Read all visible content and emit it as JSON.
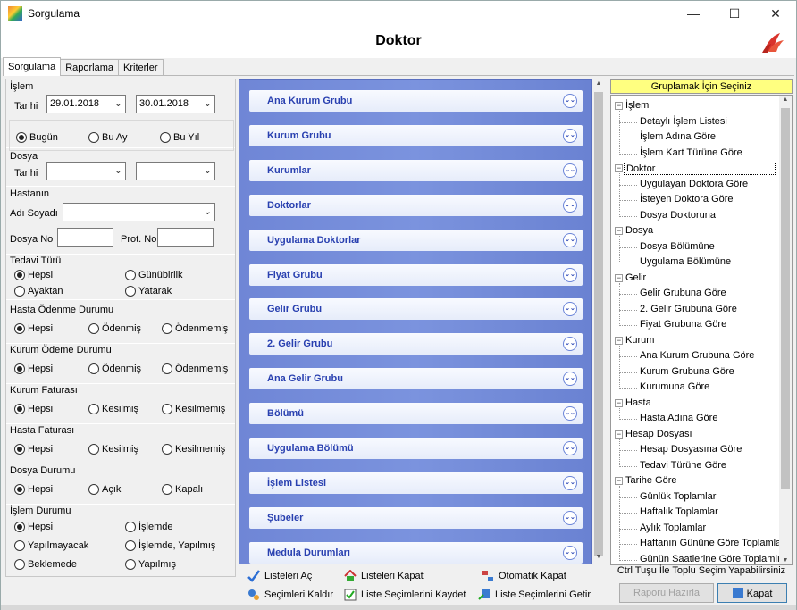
{
  "window": {
    "title": "Sorgulama",
    "min": "—",
    "max": "☐",
    "close": "✕"
  },
  "header": {
    "title": "Doktor"
  },
  "tabs": [
    "Sorgulama",
    "Raporlama",
    "Kriterler"
  ],
  "left": {
    "islem": {
      "title": "İşlem",
      "tarihi_label": "Tarihi",
      "date_from": "29.01.2018",
      "date_to": "30.01.2018",
      "radios": [
        "Bugün",
        "Bu Ay",
        "Bu Yıl"
      ]
    },
    "dosya": {
      "title": "Dosya",
      "tarihi_label": "Tarihi"
    },
    "hastanin": {
      "title": "Hastanın",
      "adi_label": "Adı Soyadı",
      "dosya_no_label": "Dosya No",
      "prot_no_label": "Prot. No"
    },
    "tedavi": {
      "title": "Tedavi Türü",
      "opts": [
        "Hepsi",
        "Günübirlik",
        "Ayaktan",
        "Yatarak"
      ]
    },
    "hasta_odeme": {
      "title": "Hasta Ödenme Durumu",
      "opts": [
        "Hepsi",
        "Ödenmiş",
        "Ödenmemiş"
      ]
    },
    "kurum_odeme": {
      "title": "Kurum Ödeme Durumu",
      "opts": [
        "Hepsi",
        "Ödenmiş",
        "Ödenmemiş"
      ]
    },
    "kurum_fatura": {
      "title": "Kurum Faturası",
      "opts": [
        "Hepsi",
        "Kesilmiş",
        "Kesilmemiş"
      ]
    },
    "hasta_fatura": {
      "title": "Hasta Faturası",
      "opts": [
        "Hepsi",
        "Kesilmiş",
        "Kesilmemiş"
      ]
    },
    "dosya_durum": {
      "title": "Dosya Durumu",
      "opts": [
        "Hepsi",
        "Açık",
        "Kapalı"
      ]
    },
    "islem_durum": {
      "title": "İşlem Durumu",
      "opts": [
        "Hepsi",
        "İşlemde",
        "Yapılmayacak",
        "İşlemde, Yapılmış",
        "Beklemede",
        "Yapılmış"
      ]
    }
  },
  "groups": [
    "Ana Kurum Grubu",
    "Kurum Grubu",
    "Kurumlar",
    "Doktorlar",
    "Uygulama Doktorlar",
    "Fiyat Grubu",
    "Gelir Grubu",
    "2. Gelir Grubu",
    "Ana Gelir Grubu",
    "Bölümü",
    "Uygulama Bölümü",
    "İşlem Listesi",
    "Şubeler",
    "Medula Durumları"
  ],
  "actions": {
    "listeleri_ac": "Listeleri Aç",
    "listeleri_kapat": "Listeleri Kapat",
    "otomatik_kapat": "Otomatik Kapat",
    "secimleri_kaldir": "Seçimleri Kaldır",
    "liste_kaydet": "Liste Seçimlerini Kaydet",
    "liste_getir": "Liste Seçimlerini Getir"
  },
  "tree": {
    "header": "Gruplamak İçin Seçiniz",
    "nodes": [
      {
        "label": "İşlem",
        "children": [
          "Detaylı İşlem Listesi",
          "İşlem Adına Göre",
          "İşlem Kart Türüne Göre"
        ]
      },
      {
        "label": "Doktor",
        "children": [
          "Uygulayan Doktora Göre",
          "İsteyen Doktora Göre",
          "Dosya Doktoruna"
        ]
      },
      {
        "label": "Dosya",
        "children": [
          "Dosya Bölümüne",
          "Uygulama Bölümüne"
        ]
      },
      {
        "label": "Gelir",
        "children": [
          "Gelir Grubuna Göre",
          "2. Gelir Grubuna Göre",
          "Fiyat Grubuna Göre"
        ]
      },
      {
        "label": "Kurum",
        "children": [
          "Ana Kurum Grubuna Göre",
          "Kurum Grubuna Göre",
          "Kurumuna Göre"
        ]
      },
      {
        "label": "Hasta",
        "children": [
          "Hasta Adına Göre"
        ]
      },
      {
        "label": "Hesap Dosyası",
        "children": [
          "Hesap Dosyasına Göre",
          "Tedavi Türüne Göre"
        ]
      },
      {
        "label": "Tarihe Göre",
        "children": [
          "Günlük Toplamlar",
          "Haftalık Toplamlar",
          "Aylık Toplamlar",
          "Haftanın Gününe Göre Toplamla",
          "Günün Saatlerine Göre Toplamlı"
        ]
      }
    ]
  },
  "hint": "Ctrl Tuşu İle Toplu Seçim Yapabilirsiniz",
  "buttons": {
    "rapor": "Raporu Hazırla",
    "kapat": "Kapat"
  }
}
